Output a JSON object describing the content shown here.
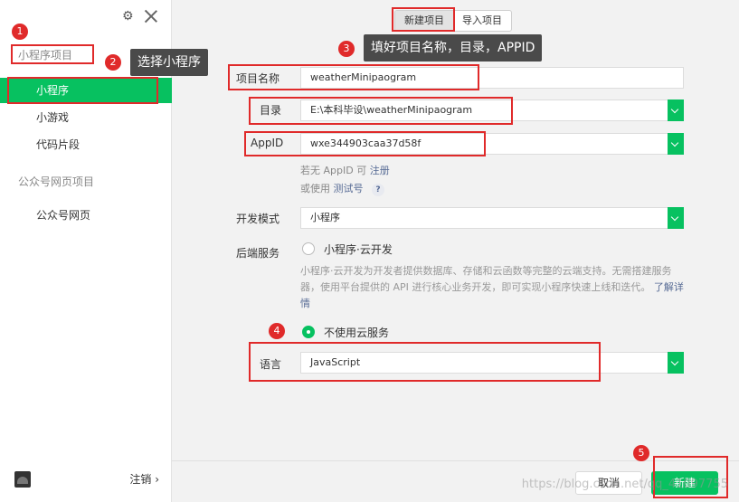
{
  "sidebar": {
    "section1": "小程序项目",
    "items1": [
      {
        "label": "小程序",
        "active": true
      },
      {
        "label": "小游戏",
        "active": false
      },
      {
        "label": "代码片段",
        "active": false
      }
    ],
    "section2": "公众号网页项目",
    "items2": [
      {
        "label": "公众号网页"
      }
    ],
    "logout": "注销 ›"
  },
  "tabs": {
    "new_project": "新建项目",
    "import_project": "导入项目"
  },
  "form": {
    "project_name_label": "项目名称",
    "project_name_value": "weatherMinipaogram",
    "directory_label": "目录",
    "directory_value": "E:\\本科毕设\\weatherMinipaogram",
    "appid_label": "AppID",
    "appid_value": "wxe344903caa37d58f",
    "appid_hint_prefix": "若无 AppID 可",
    "appid_hint_link": "注册",
    "appid_hint2_prefix": "或使用",
    "appid_hint2_link": "测试号",
    "help_symbol": "?",
    "dev_mode_label": "开发模式",
    "dev_mode_value": "小程序",
    "backend_label": "后端服务",
    "backend_option_cloud": "小程序·云开发",
    "backend_desc": "小程序·云开发为开发者提供数据库、存储和云函数等完整的云端支持。无需搭建服务器，使用平台提供的 API 进行核心业务开发，即可实现小程序快速上线和迭代。",
    "backend_desc_link": "了解详情",
    "backend_option_none": "不使用云服务",
    "language_label": "语言",
    "language_value": "JavaScript"
  },
  "footer": {
    "cancel": "取消",
    "create": "新建"
  },
  "annotations": {
    "badge1": "1",
    "badge2": "2",
    "callout2": "选择小程序",
    "badge3": "3",
    "callout3": "填好项目名称，目录，APPID",
    "badge4": "4",
    "badge5": "5"
  },
  "watermark": "https://blog.csdn.net/qq_41097755",
  "colors": {
    "accent": "#07c160",
    "annotation": "#e02a2a"
  }
}
